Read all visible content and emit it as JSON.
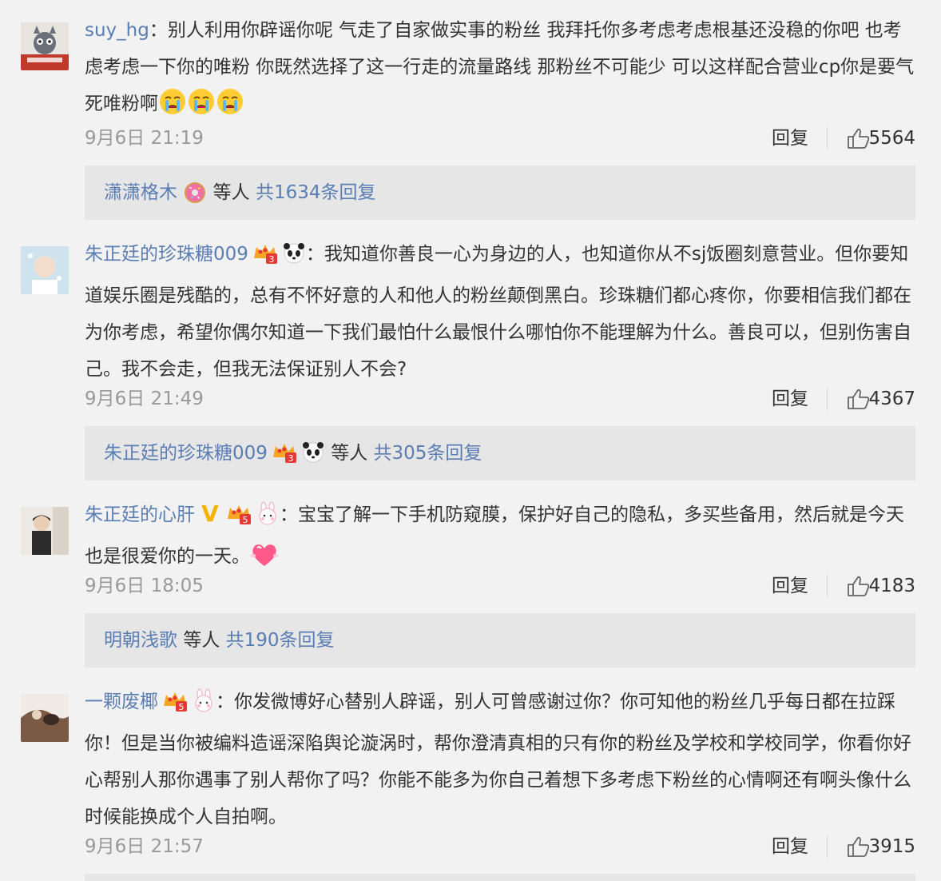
{
  "comments": [
    {
      "username": "suy_hg",
      "text": "别人利用你辟谣你呢 气走了自家做实事的粉丝 我拜托你多考虑考虑根基还没稳的你吧 也考虑考虑一下你的唯粉 你既然选择了这一行走的流量路线 那粉丝不可能少 可以这样配合营业cp你是要气死唯粉啊",
      "time": "9月6日 21:19",
      "reply_label": "回复",
      "likes": "5564",
      "replies": {
        "name": "潇潇格木",
        "mid": "等人",
        "total": "共1634条回复"
      }
    },
    {
      "username": "朱正廷的珍珠糖009",
      "text": "我知道你善良一心为身边的人，也知道你从不sj饭圈刻意营业。但你要知道娱乐圈是残酷的，总有不怀好意的人和他人的粉丝颠倒黑白。珍珠糖们都心疼你，你要相信我们都在为你考虑，希望你偶尔知道一下我们最怕什么最恨什么哪怕你不能理解为什么。善良可以，但别伤害自己。我不会走，但我无法保证别人不会?",
      "time": "9月6日 21:49",
      "reply_label": "回复",
      "likes": "4367",
      "replies": {
        "name": "朱正廷的珍珠糖009",
        "mid": "等人",
        "total": "共305条回复"
      }
    },
    {
      "username": "朱正廷的心肝",
      "text": "宝宝了解一下手机防窥膜，保护好自己的隐私，多买些备用，然后就是今天也是很爱你的一天。",
      "time": "9月6日 18:05",
      "reply_label": "回复",
      "likes": "4183",
      "replies": {
        "name": "明朝浅歌",
        "mid": "等人",
        "total": "共190条回复"
      }
    },
    {
      "username": "一颗废椰",
      "text": "你发微博好心替别人辟谣，别人可曾感谢过你？你可知他的粉丝几乎每日都在拉踩你！但是当你被编料造谣深陷舆论漩涡时，帮你澄清真相的只有你的粉丝及学校和学校同学，你看你好心帮别人那你遇事了别人帮你了吗？你能不能多为你自己着想下多考虑下粉丝的心情啊还有啊头像什么时候能换成个人自拍啊。",
      "time": "9月6日 21:57",
      "reply_label": "回复",
      "likes": "3915"
    }
  ],
  "colon": "：",
  "badges": {
    "vip_level_3": "3",
    "vip_level_5": "5",
    "verified": "V"
  },
  "colors": {
    "username": "#5a7db3",
    "text": "#333333",
    "meta": "#999999",
    "background": "#f2f2f2",
    "reply_box": "#e6e6e6",
    "verified": "#f5b400"
  },
  "icons": [
    "crying-emoji",
    "donut-emoji",
    "crown-vip-icon",
    "panda-icon",
    "bunny-icon",
    "heart-emoji",
    "thumbs-up-icon",
    "verified-v-icon"
  ]
}
